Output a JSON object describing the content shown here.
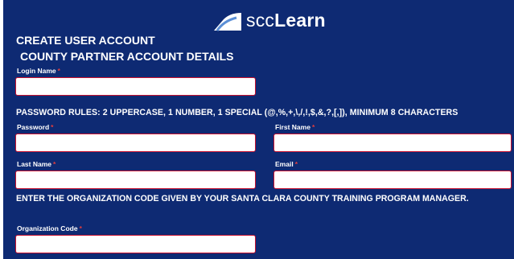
{
  "brand": {
    "name_part1": "scc",
    "name_part2": "Learn"
  },
  "heading": {
    "create_account": "CREATE USER ACCOUNT",
    "section": "COUNTY PARTNER ACCOUNT DETAILS"
  },
  "fields": {
    "login_name": {
      "label": "Login Name",
      "value": ""
    },
    "password": {
      "label": "Password",
      "value": ""
    },
    "first_name": {
      "label": "First Name",
      "value": ""
    },
    "last_name": {
      "label": "Last Name",
      "value": ""
    },
    "email": {
      "label": "Email",
      "value": ""
    },
    "organization_code": {
      "label": "Organization Code",
      "value": ""
    }
  },
  "required_marker": "*",
  "password_rules": "PASSWORD RULES: 2 UPPERCASE, 1 NUMBER, 1 SPECIAL (@,%,+,\\,/,!,$,&,?,[,]), MINIMUM 8 CHARACTERS",
  "org_instructions": "ENTER THE ORGANIZATION CODE GIVEN BY YOUR SANTA CLARA COUNTY TRAINING PROGRAM MANAGER.",
  "colors": {
    "panel_background": "#0e2a73",
    "field_border": "#c8102e",
    "required_marker": "#e23d3d"
  }
}
